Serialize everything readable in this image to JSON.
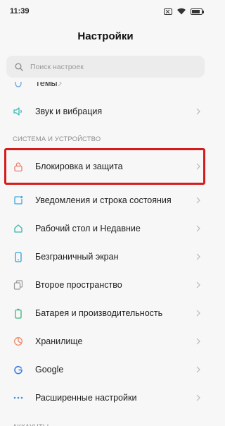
{
  "status_bar": {
    "time": "11:39"
  },
  "header": {
    "title": "Настройки"
  },
  "search": {
    "placeholder": "Поиск настроек"
  },
  "top_items": [
    {
      "label": "Темы",
      "icon": "themes-icon"
    },
    {
      "label": "Звук и вибрация",
      "icon": "sound-icon"
    }
  ],
  "section_system": {
    "title": "СИСТЕМА И УСТРОЙСТВО"
  },
  "system_items": [
    {
      "label": "Блокировка и защита",
      "icon": "lock-icon",
      "highlighted": true
    },
    {
      "label": "Уведомления и строка состояния",
      "icon": "notifications-icon"
    },
    {
      "label": "Рабочий стол и Недавние",
      "icon": "home-icon"
    },
    {
      "label": "Безграничный экран",
      "icon": "fullscreen-icon"
    },
    {
      "label": "Второе пространство",
      "icon": "second-space-icon"
    },
    {
      "label": "Батарея и производительность",
      "icon": "battery-icon"
    },
    {
      "label": "Хранилище",
      "icon": "storage-icon"
    },
    {
      "label": "Google",
      "icon": "google-icon"
    },
    {
      "label": "Расширенные настройки",
      "icon": "more-icon"
    }
  ],
  "section_accounts": {
    "title": "АККАУНТЫ"
  },
  "colors": {
    "highlight": "#d41c1c",
    "background": "#f7f7f7"
  }
}
